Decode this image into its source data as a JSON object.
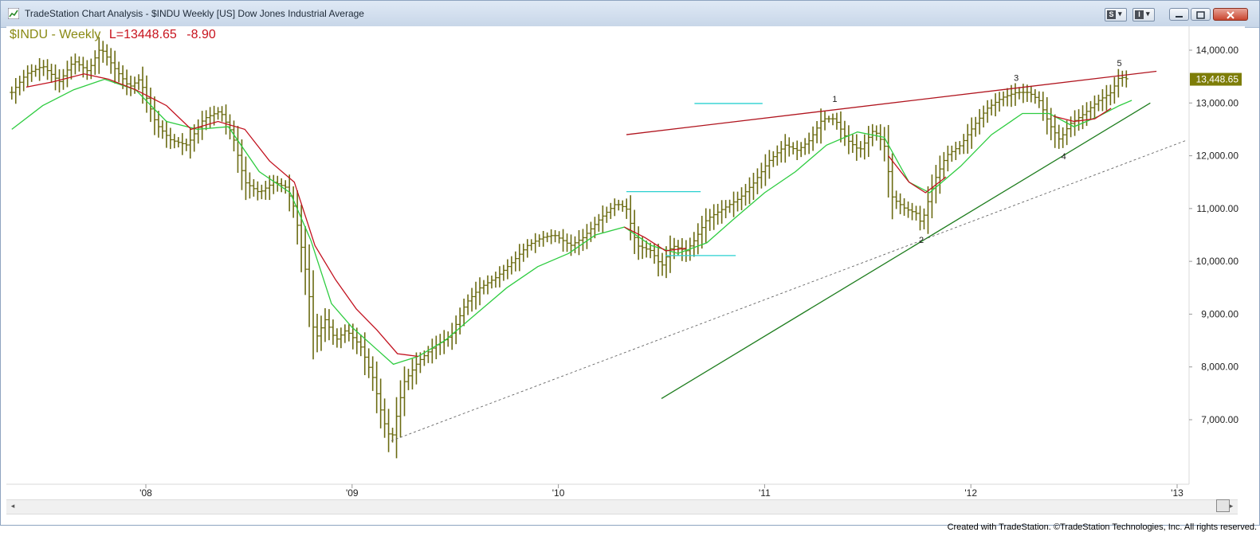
{
  "window": {
    "title": "TradeStation Chart Analysis - $INDU Weekly [US] Dow Jones Industrial Average",
    "toolbar_buttons": [
      {
        "label": "S",
        "icon": "dropdown-arrow-icon"
      },
      {
        "label": "I",
        "icon": "dropdown-arrow-icon"
      }
    ],
    "controls": [
      "minimize-icon",
      "maximize-icon",
      "close-icon"
    ]
  },
  "header": {
    "symbol": "$INDU - Weekly",
    "last_label": "L=13448.65",
    "change": "-8.90"
  },
  "colors": {
    "bars": "#6b6b12",
    "ma_fast": "#2ecc40",
    "ma_slow": "#c2121f",
    "resistance_line": "#b0141e",
    "support_line": "#1e7d1e",
    "dashed_line": "#666666",
    "marker_line": "#2ad0d0",
    "price_tag": "#7d7d08",
    "header_symbol": "#8a8a14",
    "header_last": "#c8141e"
  },
  "chart_data": {
    "type": "ohlc",
    "frequency": "weekly",
    "ylim": [
      6300,
      14500
    ],
    "xlim": [
      2007.35,
      2013.13
    ],
    "yticks": [
      {
        "value": 14000,
        "label": "14,000.00"
      },
      {
        "value": 13000,
        "label": "13,000.00"
      },
      {
        "value": 12000,
        "label": "12,000.00"
      },
      {
        "value": 11000,
        "label": "11,000.00"
      },
      {
        "value": 10000,
        "label": "10,000.00"
      },
      {
        "value": 9000,
        "label": "9,000.00"
      },
      {
        "value": 8000,
        "label": "8,000.00"
      },
      {
        "value": 7000,
        "label": "7,000.00"
      }
    ],
    "xticks": [
      {
        "value": 2008.0,
        "label": "'08"
      },
      {
        "value": 2009.0,
        "label": "'09"
      },
      {
        "value": 2010.0,
        "label": "'10"
      },
      {
        "value": 2011.0,
        "label": "'11"
      },
      {
        "value": 2012.0,
        "label": "'12"
      },
      {
        "value": 2013.0,
        "label": "'13"
      }
    ],
    "last_price_label": "13,448.65",
    "last_price": 13448.65,
    "close_path": [
      [
        2007.35,
        13200
      ],
      [
        2007.42,
        13550
      ],
      [
        2007.5,
        13700
      ],
      [
        2007.58,
        13400
      ],
      [
        2007.65,
        13800
      ],
      [
        2007.72,
        13600
      ],
      [
        2007.78,
        14050
      ],
      [
        2007.85,
        13650
      ],
      [
        2007.92,
        13300
      ],
      [
        2007.97,
        13450
      ],
      [
        2008.05,
        12600
      ],
      [
        2008.12,
        12300
      ],
      [
        2008.2,
        12200
      ],
      [
        2008.28,
        12700
      ],
      [
        2008.36,
        12850
      ],
      [
        2008.42,
        12400
      ],
      [
        2008.48,
        11500
      ],
      [
        2008.55,
        11300
      ],
      [
        2008.62,
        11500
      ],
      [
        2008.68,
        11400
      ],
      [
        2008.72,
        11000
      ],
      [
        2008.78,
        9700
      ],
      [
        2008.82,
        8500
      ],
      [
        2008.87,
        8900
      ],
      [
        2008.92,
        8500
      ],
      [
        2008.97,
        8700
      ],
      [
        2009.04,
        8400
      ],
      [
        2009.1,
        7800
      ],
      [
        2009.15,
        7000
      ],
      [
        2009.19,
        6600
      ],
      [
        2009.25,
        7700
      ],
      [
        2009.32,
        8100
      ],
      [
        2009.4,
        8400
      ],
      [
        2009.48,
        8600
      ],
      [
        2009.55,
        9200
      ],
      [
        2009.62,
        9500
      ],
      [
        2009.7,
        9700
      ],
      [
        2009.78,
        10000
      ],
      [
        2009.85,
        10300
      ],
      [
        2009.92,
        10450
      ],
      [
        2009.98,
        10500
      ],
      [
        2010.06,
        10300
      ],
      [
        2010.12,
        10450
      ],
      [
        2010.2,
        10800
      ],
      [
        2010.28,
        11100
      ],
      [
        2010.33,
        11000
      ],
      [
        2010.38,
        10300
      ],
      [
        2010.45,
        10200
      ],
      [
        2010.5,
        9900
      ],
      [
        2010.55,
        10300
      ],
      [
        2010.62,
        10200
      ],
      [
        2010.66,
        10400
      ],
      [
        2010.72,
        10800
      ],
      [
        2010.8,
        11000
      ],
      [
        2010.88,
        11200
      ],
      [
        2010.95,
        11500
      ],
      [
        2011.02,
        11900
      ],
      [
        2011.1,
        12200
      ],
      [
        2011.16,
        12100
      ],
      [
        2011.22,
        12300
      ],
      [
        2011.28,
        12700
      ],
      [
        2011.34,
        12700
      ],
      [
        2011.4,
        12300
      ],
      [
        2011.46,
        12100
      ],
      [
        2011.53,
        12500
      ],
      [
        2011.58,
        12200
      ],
      [
        2011.62,
        11200
      ],
      [
        2011.68,
        11000
      ],
      [
        2011.74,
        10900
      ],
      [
        2011.76,
        10700
      ],
      [
        2011.82,
        11500
      ],
      [
        2011.88,
        12000
      ],
      [
        2011.95,
        12200
      ],
      [
        2012.02,
        12600
      ],
      [
        2012.08,
        12900
      ],
      [
        2012.15,
        13100
      ],
      [
        2012.22,
        13200
      ],
      [
        2012.28,
        13200
      ],
      [
        2012.33,
        13050
      ],
      [
        2012.38,
        12600
      ],
      [
        2012.43,
        12300
      ],
      [
        2012.48,
        12600
      ],
      [
        2012.55,
        12800
      ],
      [
        2012.62,
        13050
      ],
      [
        2012.68,
        13200
      ],
      [
        2012.72,
        13500
      ],
      [
        2012.76,
        13450
      ]
    ],
    "ma_fast_path": [
      [
        2007.35,
        12500
      ],
      [
        2007.5,
        12950
      ],
      [
        2007.65,
        13250
      ],
      [
        2007.8,
        13450
      ],
      [
        2007.95,
        13250
      ],
      [
        2008.1,
        12650
      ],
      [
        2008.25,
        12500
      ],
      [
        2008.4,
        12550
      ],
      [
        2008.55,
        11700
      ],
      [
        2008.7,
        11300
      ],
      [
        2008.8,
        10400
      ],
      [
        2008.9,
        9200
      ],
      [
        2009.0,
        8750
      ],
      [
        2009.1,
        8400
      ],
      [
        2009.2,
        8050
      ],
      [
        2009.32,
        8200
      ],
      [
        2009.45,
        8500
      ],
      [
        2009.6,
        9000
      ],
      [
        2009.75,
        9500
      ],
      [
        2009.9,
        9900
      ],
      [
        2010.05,
        10150
      ],
      [
        2010.18,
        10500
      ],
      [
        2010.32,
        10650
      ],
      [
        2010.45,
        10300
      ],
      [
        2010.58,
        10150
      ],
      [
        2010.72,
        10350
      ],
      [
        2010.85,
        10800
      ],
      [
        2011.0,
        11300
      ],
      [
        2011.15,
        11700
      ],
      [
        2011.3,
        12200
      ],
      [
        2011.45,
        12450
      ],
      [
        2011.58,
        12350
      ],
      [
        2011.7,
        11500
      ],
      [
        2011.8,
        11300
      ],
      [
        2011.95,
        11800
      ],
      [
        2012.1,
        12400
      ],
      [
        2012.25,
        12800
      ],
      [
        2012.38,
        12800
      ],
      [
        2012.5,
        12550
      ],
      [
        2012.62,
        12750
      ],
      [
        2012.72,
        12950
      ],
      [
        2012.78,
        13050
      ]
    ],
    "ma_slow_path": [
      [
        2007.42,
        13300
      ],
      [
        2007.55,
        13400
      ],
      [
        2007.7,
        13550
      ],
      [
        2007.82,
        13450
      ],
      [
        2007.95,
        13250
      ],
      [
        2008.1,
        12950
      ],
      [
        2008.22,
        12500
      ],
      [
        2008.35,
        12650
      ],
      [
        2008.48,
        12500
      ],
      [
        2008.6,
        11900
      ],
      [
        2008.72,
        11500
      ],
      [
        2008.82,
        10300
      ],
      [
        2008.92,
        9650
      ],
      [
        2009.02,
        9100
      ],
      [
        2009.12,
        8700
      ],
      [
        2009.22,
        8250
      ],
      [
        2009.32,
        8200
      ]
    ],
    "ma_slow_path_2": [
      [
        2010.32,
        10650
      ],
      [
        2010.42,
        10450
      ],
      [
        2010.52,
        10200
      ],
      [
        2010.62,
        10250
      ]
    ],
    "ma_slow_path_3": [
      [
        2011.6,
        12000
      ],
      [
        2011.7,
        11500
      ],
      [
        2011.78,
        11300
      ],
      [
        2011.88,
        11600
      ]
    ],
    "ma_slow_path_4": [
      [
        2012.4,
        12750
      ],
      [
        2012.5,
        12650
      ],
      [
        2012.6,
        12700
      ],
      [
        2012.68,
        12900
      ]
    ],
    "trendlines": [
      {
        "name": "resistance",
        "from": [
          2010.33,
          12400
        ],
        "to": [
          2012.9,
          13600
        ],
        "style": "solid"
      },
      {
        "name": "support",
        "from": [
          2010.5,
          7400
        ],
        "to": [
          2012.87,
          13000
        ],
        "style": "solid"
      },
      {
        "name": "lower-channel",
        "from": [
          2009.19,
          6600
        ],
        "to": [
          2013.05,
          12300
        ],
        "style": "dashed"
      }
    ],
    "marker_lines": [
      {
        "from": [
          2010.66,
          12990
        ],
        "to": [
          2010.99,
          12990
        ]
      },
      {
        "from": [
          2010.33,
          11320
        ],
        "to": [
          2010.69,
          11320
        ]
      },
      {
        "from": [
          2010.52,
          10110
        ],
        "to": [
          2010.86,
          10110
        ]
      }
    ],
    "wave_labels": [
      {
        "label": "1",
        "x": 2011.34,
        "y": 13020
      },
      {
        "label": "2",
        "x": 2011.76,
        "y": 10350
      },
      {
        "label": "3",
        "x": 2012.22,
        "y": 13420
      },
      {
        "label": "4",
        "x": 2012.45,
        "y": 11930
      },
      {
        "label": "5",
        "x": 2012.72,
        "y": 13700
      }
    ]
  },
  "footer": {
    "text": "Created with TradeStation. ©TradeStation Technologies, Inc. All rights reserved."
  }
}
